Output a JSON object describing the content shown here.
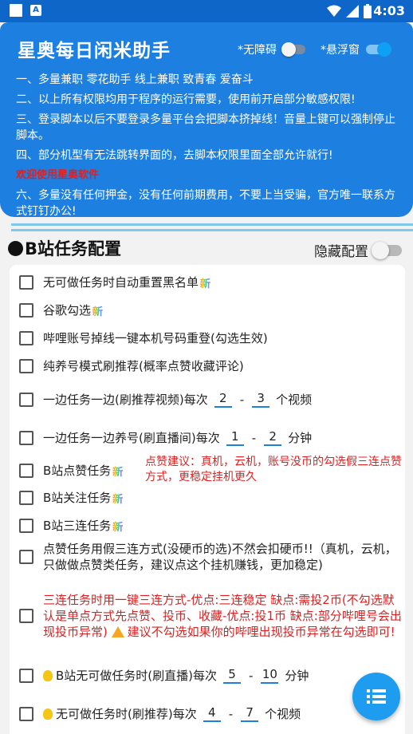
{
  "status_bar": {
    "time": "4:03"
  },
  "header": {
    "title": "星奥每日闲米助手",
    "accessibility_label": "*无障碍",
    "float_label": "*悬浮窗",
    "notes": [
      "一、多量兼职  零花助手 线上兼职  致青春  爱奋斗",
      "二、以上所有权限均用于程序的运行需要，使用前开启部分敏感权限!",
      "三、登录脚本以后不要登录多量平台会把脚本挤掉线！音量上键可以强制停止脚本。",
      "四、部分机型有无法跳转界面的，去脚本权限里面全部允许就行!",
      "六、多量没有任何押金，没有任何前期费用，不要上当受骗，官方唯一联系方式钉钉办公!"
    ],
    "welcome": "欢迎使用星奥软件"
  },
  "section": {
    "title": "B站任务配置",
    "hide_label": "隐藏配置"
  },
  "options": {
    "auto_reset": "无可做任务时自动重置黑名单",
    "google_check": "谷歌勾选",
    "relogin": "哔哩账号掉线一键本机号码重登(勾选生效)",
    "pure_raise": "纯养号模式刷推荐(概率点赞收藏评论)",
    "side_video_prefix": "一边任务一边(刷推荐视频)每次",
    "side_video_min": "2",
    "side_video_max": "3",
    "side_video_unit": "个视频",
    "side_live_prefix": "一边任务一边养号(刷直播间)每次",
    "side_live_min": "1",
    "side_live_max": "2",
    "side_live_unit": "分钟",
    "like_task": "B站点赞任务",
    "like_advice": "点赞建议：真机，云机，账号没币的勾选假三连点赞方式，更稳定挂机更久",
    "follow_task": "B站关注任务",
    "triple_task": "B站三连任务",
    "fake_triple": "点赞任务用假三连方式(没硬币的选)不然会扣硬币!!（真机，云机，只做做点赞类任务，建议点这个挂机赚钱，更加稳定)",
    "one_key_triple": "三连任务时用一键三连方式-优点:三连稳定 缺点:需投2币(不勾选默认是单点方式先点赞、投币、收藏-优点:投1币 缺点:部分哔哩号会出现投币异常)",
    "one_key_triple_warn": "建议不勾选如果你的哔哩出现投币异常在勾选即可!",
    "no_task_live_prefix": "B站无可做任务时(刷直播)每次",
    "no_task_live_min": "5",
    "no_task_live_max": "10",
    "no_task_live_unit": "分钟",
    "no_task_rec_prefix": "无可做任务时(刷推荐)每次",
    "no_task_rec_min": "4",
    "no_task_rec_max": "7",
    "no_task_rec_unit": "个视频",
    "new_badge": "新",
    "dash": "-"
  },
  "icons": {
    "fab": "list-icon",
    "bulb": "lightbulb-icon",
    "warning": "warning-icon"
  },
  "colors": {
    "primary": "#1d7fe0",
    "accent": "#1d9cf0",
    "alert": "#e02020"
  }
}
